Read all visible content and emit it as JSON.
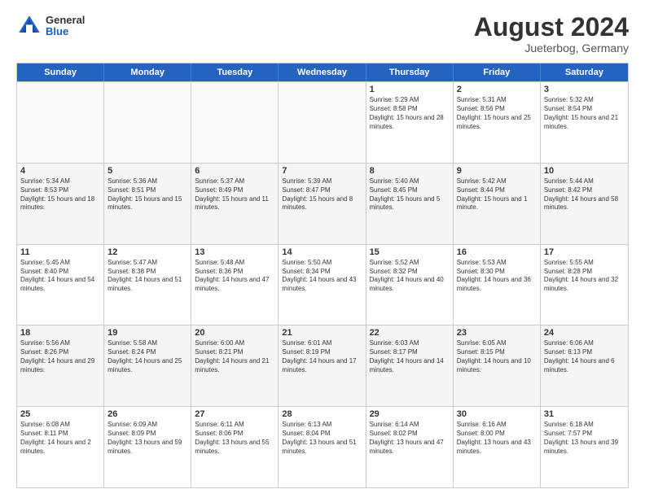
{
  "header": {
    "logo_general": "General",
    "logo_blue": "Blue",
    "title": "August 2024",
    "subtitle": "Jueterbog, Germany"
  },
  "days": [
    "Sunday",
    "Monday",
    "Tuesday",
    "Wednesday",
    "Thursday",
    "Friday",
    "Saturday"
  ],
  "weeks": [
    [
      {
        "day": "",
        "empty": true
      },
      {
        "day": "",
        "empty": true
      },
      {
        "day": "",
        "empty": true
      },
      {
        "day": "",
        "empty": true
      },
      {
        "day": "1",
        "sunrise": "Sunrise: 5:29 AM",
        "sunset": "Sunset: 8:58 PM",
        "daylight": "Daylight: 15 hours and 28 minutes."
      },
      {
        "day": "2",
        "sunrise": "Sunrise: 5:31 AM",
        "sunset": "Sunset: 8:56 PM",
        "daylight": "Daylight: 15 hours and 25 minutes."
      },
      {
        "day": "3",
        "sunrise": "Sunrise: 5:32 AM",
        "sunset": "Sunset: 8:54 PM",
        "daylight": "Daylight: 15 hours and 21 minutes."
      }
    ],
    [
      {
        "day": "4",
        "sunrise": "Sunrise: 5:34 AM",
        "sunset": "Sunset: 8:53 PM",
        "daylight": "Daylight: 15 hours and 18 minutes."
      },
      {
        "day": "5",
        "sunrise": "Sunrise: 5:36 AM",
        "sunset": "Sunset: 8:51 PM",
        "daylight": "Daylight: 15 hours and 15 minutes."
      },
      {
        "day": "6",
        "sunrise": "Sunrise: 5:37 AM",
        "sunset": "Sunset: 8:49 PM",
        "daylight": "Daylight: 15 hours and 11 minutes."
      },
      {
        "day": "7",
        "sunrise": "Sunrise: 5:39 AM",
        "sunset": "Sunset: 8:47 PM",
        "daylight": "Daylight: 15 hours and 8 minutes."
      },
      {
        "day": "8",
        "sunrise": "Sunrise: 5:40 AM",
        "sunset": "Sunset: 8:45 PM",
        "daylight": "Daylight: 15 hours and 5 minutes."
      },
      {
        "day": "9",
        "sunrise": "Sunrise: 5:42 AM",
        "sunset": "Sunset: 8:44 PM",
        "daylight": "Daylight: 15 hours and 1 minute."
      },
      {
        "day": "10",
        "sunrise": "Sunrise: 5:44 AM",
        "sunset": "Sunset: 8:42 PM",
        "daylight": "Daylight: 14 hours and 58 minutes."
      }
    ],
    [
      {
        "day": "11",
        "sunrise": "Sunrise: 5:45 AM",
        "sunset": "Sunset: 8:40 PM",
        "daylight": "Daylight: 14 hours and 54 minutes."
      },
      {
        "day": "12",
        "sunrise": "Sunrise: 5:47 AM",
        "sunset": "Sunset: 8:38 PM",
        "daylight": "Daylight: 14 hours and 51 minutes."
      },
      {
        "day": "13",
        "sunrise": "Sunrise: 5:48 AM",
        "sunset": "Sunset: 8:36 PM",
        "daylight": "Daylight: 14 hours and 47 minutes."
      },
      {
        "day": "14",
        "sunrise": "Sunrise: 5:50 AM",
        "sunset": "Sunset: 8:34 PM",
        "daylight": "Daylight: 14 hours and 43 minutes."
      },
      {
        "day": "15",
        "sunrise": "Sunrise: 5:52 AM",
        "sunset": "Sunset: 8:32 PM",
        "daylight": "Daylight: 14 hours and 40 minutes."
      },
      {
        "day": "16",
        "sunrise": "Sunrise: 5:53 AM",
        "sunset": "Sunset: 8:30 PM",
        "daylight": "Daylight: 14 hours and 36 minutes."
      },
      {
        "day": "17",
        "sunrise": "Sunrise: 5:55 AM",
        "sunset": "Sunset: 8:28 PM",
        "daylight": "Daylight: 14 hours and 32 minutes."
      }
    ],
    [
      {
        "day": "18",
        "sunrise": "Sunrise: 5:56 AM",
        "sunset": "Sunset: 8:26 PM",
        "daylight": "Daylight: 14 hours and 29 minutes."
      },
      {
        "day": "19",
        "sunrise": "Sunrise: 5:58 AM",
        "sunset": "Sunset: 8:24 PM",
        "daylight": "Daylight: 14 hours and 25 minutes."
      },
      {
        "day": "20",
        "sunrise": "Sunrise: 6:00 AM",
        "sunset": "Sunset: 8:21 PM",
        "daylight": "Daylight: 14 hours and 21 minutes."
      },
      {
        "day": "21",
        "sunrise": "Sunrise: 6:01 AM",
        "sunset": "Sunset: 8:19 PM",
        "daylight": "Daylight: 14 hours and 17 minutes."
      },
      {
        "day": "22",
        "sunrise": "Sunrise: 6:03 AM",
        "sunset": "Sunset: 8:17 PM",
        "daylight": "Daylight: 14 hours and 14 minutes."
      },
      {
        "day": "23",
        "sunrise": "Sunrise: 6:05 AM",
        "sunset": "Sunset: 8:15 PM",
        "daylight": "Daylight: 14 hours and 10 minutes."
      },
      {
        "day": "24",
        "sunrise": "Sunrise: 6:06 AM",
        "sunset": "Sunset: 8:13 PM",
        "daylight": "Daylight: 14 hours and 6 minutes."
      }
    ],
    [
      {
        "day": "25",
        "sunrise": "Sunrise: 6:08 AM",
        "sunset": "Sunset: 8:11 PM",
        "daylight": "Daylight: 14 hours and 2 minutes."
      },
      {
        "day": "26",
        "sunrise": "Sunrise: 6:09 AM",
        "sunset": "Sunset: 8:09 PM",
        "daylight": "Daylight: 13 hours and 59 minutes."
      },
      {
        "day": "27",
        "sunrise": "Sunrise: 6:11 AM",
        "sunset": "Sunset: 8:06 PM",
        "daylight": "Daylight: 13 hours and 55 minutes."
      },
      {
        "day": "28",
        "sunrise": "Sunrise: 6:13 AM",
        "sunset": "Sunset: 8:04 PM",
        "daylight": "Daylight: 13 hours and 51 minutes."
      },
      {
        "day": "29",
        "sunrise": "Sunrise: 6:14 AM",
        "sunset": "Sunset: 8:02 PM",
        "daylight": "Daylight: 13 hours and 47 minutes."
      },
      {
        "day": "30",
        "sunrise": "Sunrise: 6:16 AM",
        "sunset": "Sunset: 8:00 PM",
        "daylight": "Daylight: 13 hours and 43 minutes."
      },
      {
        "day": "31",
        "sunrise": "Sunrise: 6:18 AM",
        "sunset": "Sunset: 7:57 PM",
        "daylight": "Daylight: 13 hours and 39 minutes."
      }
    ]
  ]
}
